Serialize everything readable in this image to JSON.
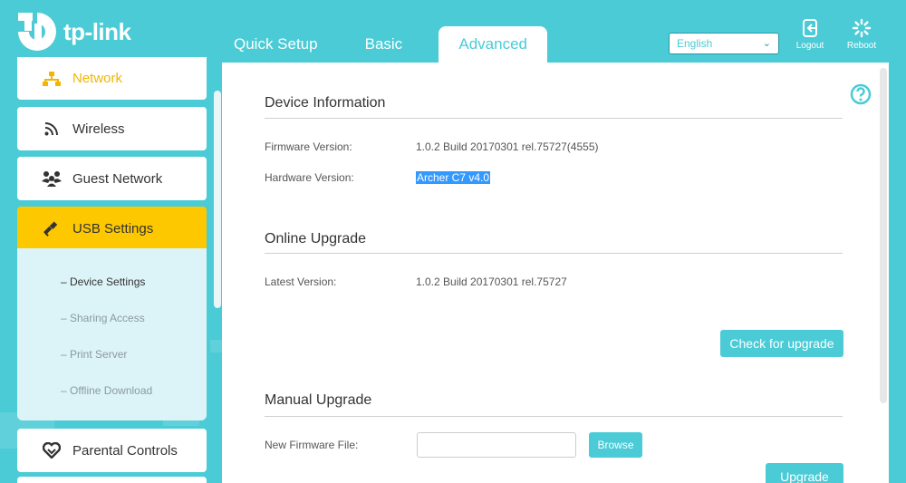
{
  "brand": {
    "logo_text": "tp-link"
  },
  "tabs": [
    {
      "label": "Quick Setup"
    },
    {
      "label": "Basic"
    },
    {
      "label": "Advanced"
    }
  ],
  "header": {
    "language": "English",
    "logout_label": "Logout",
    "reboot_label": "Reboot"
  },
  "sidebar": {
    "items": [
      {
        "label": "Network",
        "icon": "network-icon"
      },
      {
        "label": "Wireless",
        "icon": "wifi-icon"
      },
      {
        "label": "Guest Network",
        "icon": "guest-icon"
      },
      {
        "label": "USB Settings",
        "icon": "usb-icon"
      },
      {
        "label": "Parental Controls",
        "icon": "heart-icon"
      }
    ],
    "submenu": [
      {
        "label": "– Device Settings"
      },
      {
        "label": "– Sharing Access"
      },
      {
        "label": "– Print Server"
      },
      {
        "label": "– Offline Download"
      }
    ]
  },
  "device_info": {
    "title": "Device Information",
    "firmware_label": "Firmware Version:",
    "firmware_value": "1.0.2 Build 20170301 rel.75727(4555)",
    "hardware_label": "Hardware Version:",
    "hardware_value": "Archer C7 v4.0"
  },
  "online_upgrade": {
    "title": "Online Upgrade",
    "latest_label": "Latest Version:",
    "latest_value": "1.0.2 Build 20170301 rel.75727",
    "check_button": "Check for upgrade"
  },
  "manual_upgrade": {
    "title": "Manual Upgrade",
    "file_label": "New Firmware File:",
    "browse_button": "Browse",
    "upgrade_button": "Upgrade"
  },
  "colors": {
    "accent": "#4acbd6",
    "active_menu": "#fec800",
    "network_text": "#f2b600"
  }
}
